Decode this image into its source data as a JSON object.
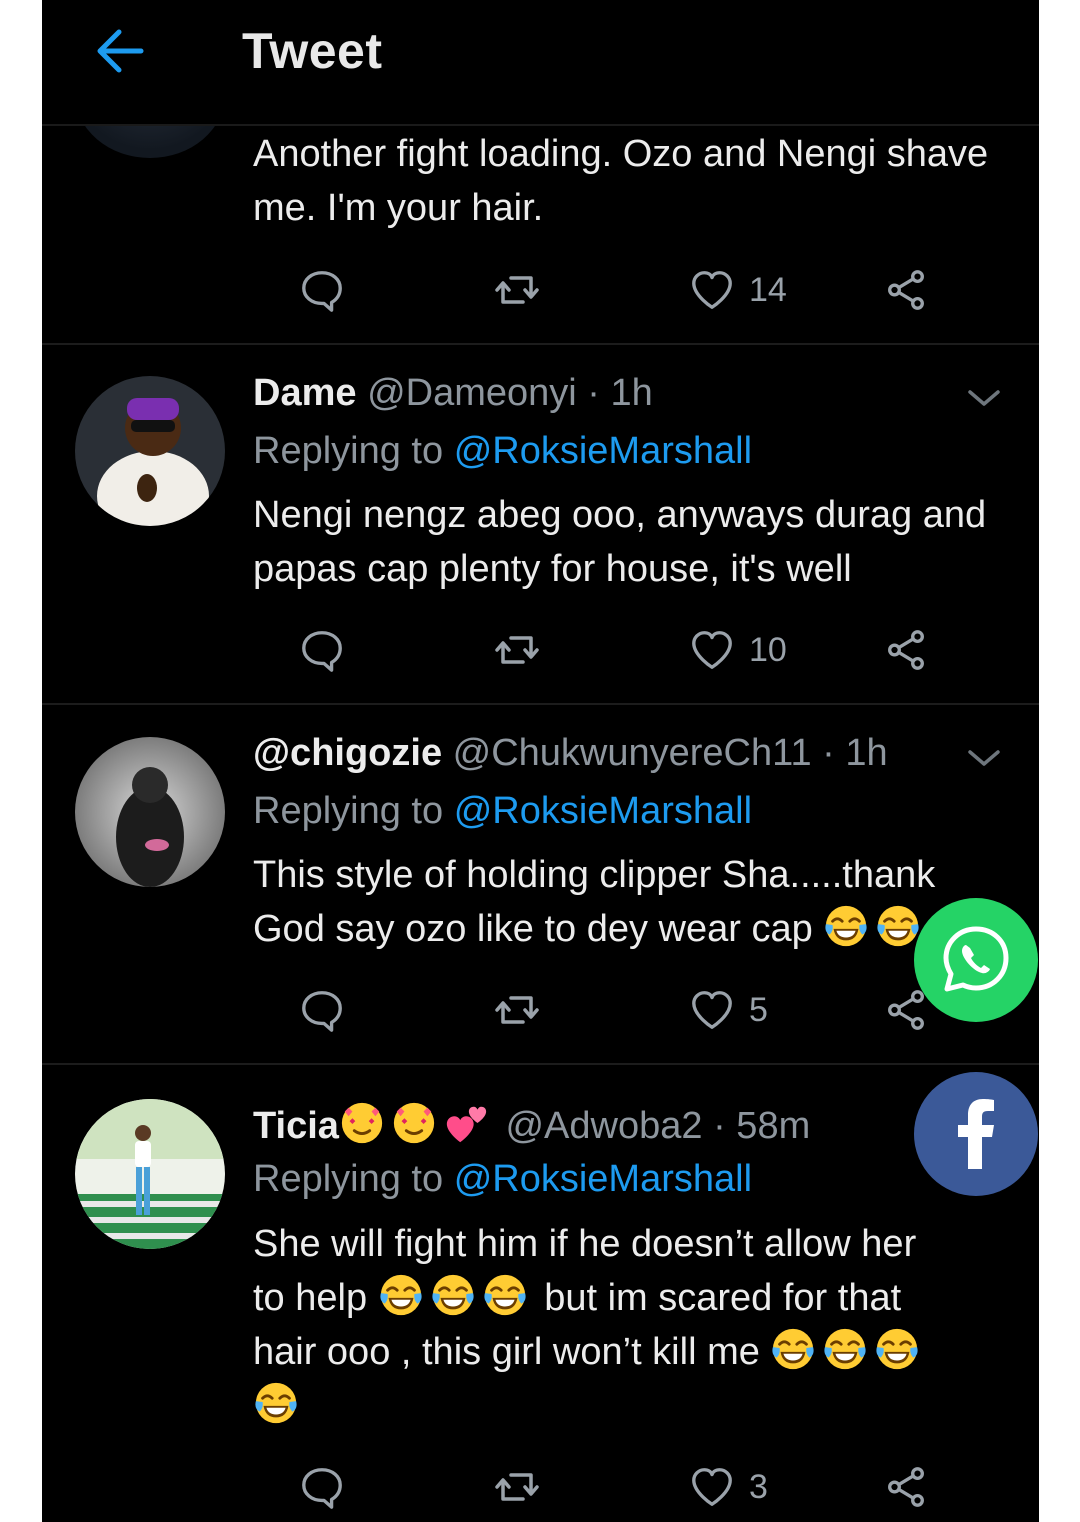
{
  "header": {
    "title": "Tweet"
  },
  "tweet0": {
    "text": "Another fight loading. Ozo and Nengi shave me. I'm your hair.",
    "likes": "14"
  },
  "tweet1": {
    "name": "Dame",
    "handle": "@Dameonyi",
    "time": "· 1h",
    "reply_prefix": "Replying to",
    "reply_to": "@RoksieMarshall",
    "text": "Nengi nengz abeg ooo, anyways durag and papas cap plenty for house, it's well",
    "likes": "10"
  },
  "tweet2": {
    "name": "@chigozie",
    "handle": "@ChukwunyereCh11",
    "time": "· 1h",
    "reply_prefix": "Replying to",
    "reply_to": "@RoksieMarshall",
    "text_line1": "This style of holding clipper Sha.....thank",
    "text_line2": "God say ozo like to dey wear cap",
    "likes": "5"
  },
  "tweet3": {
    "name": "Ticia",
    "handle": "@Adwoba2",
    "time": "· 58m",
    "reply_prefix": "Replying to",
    "reply_to": "@RoksieMarshall",
    "line1": "She will fight him if he doesn’t allow her",
    "line2a": "to help",
    "line2b": "but im scared for that",
    "line3": "hair ooo , this girl won’t kill me",
    "likes": "3"
  },
  "icons": {
    "back": "arrow-left-icon",
    "reply": "reply-bubble-icon",
    "retweet": "retweet-icon",
    "like": "heart-icon",
    "share": "share-icon",
    "whatsapp": "whatsapp-icon",
    "facebook": "facebook-icon",
    "emoji": "face-with-tears-of-joy-emoji"
  },
  "colors": {
    "background": "#000000",
    "accent": "#1d9bf0",
    "whatsapp": "#25d366",
    "facebook": "#3b5998"
  }
}
